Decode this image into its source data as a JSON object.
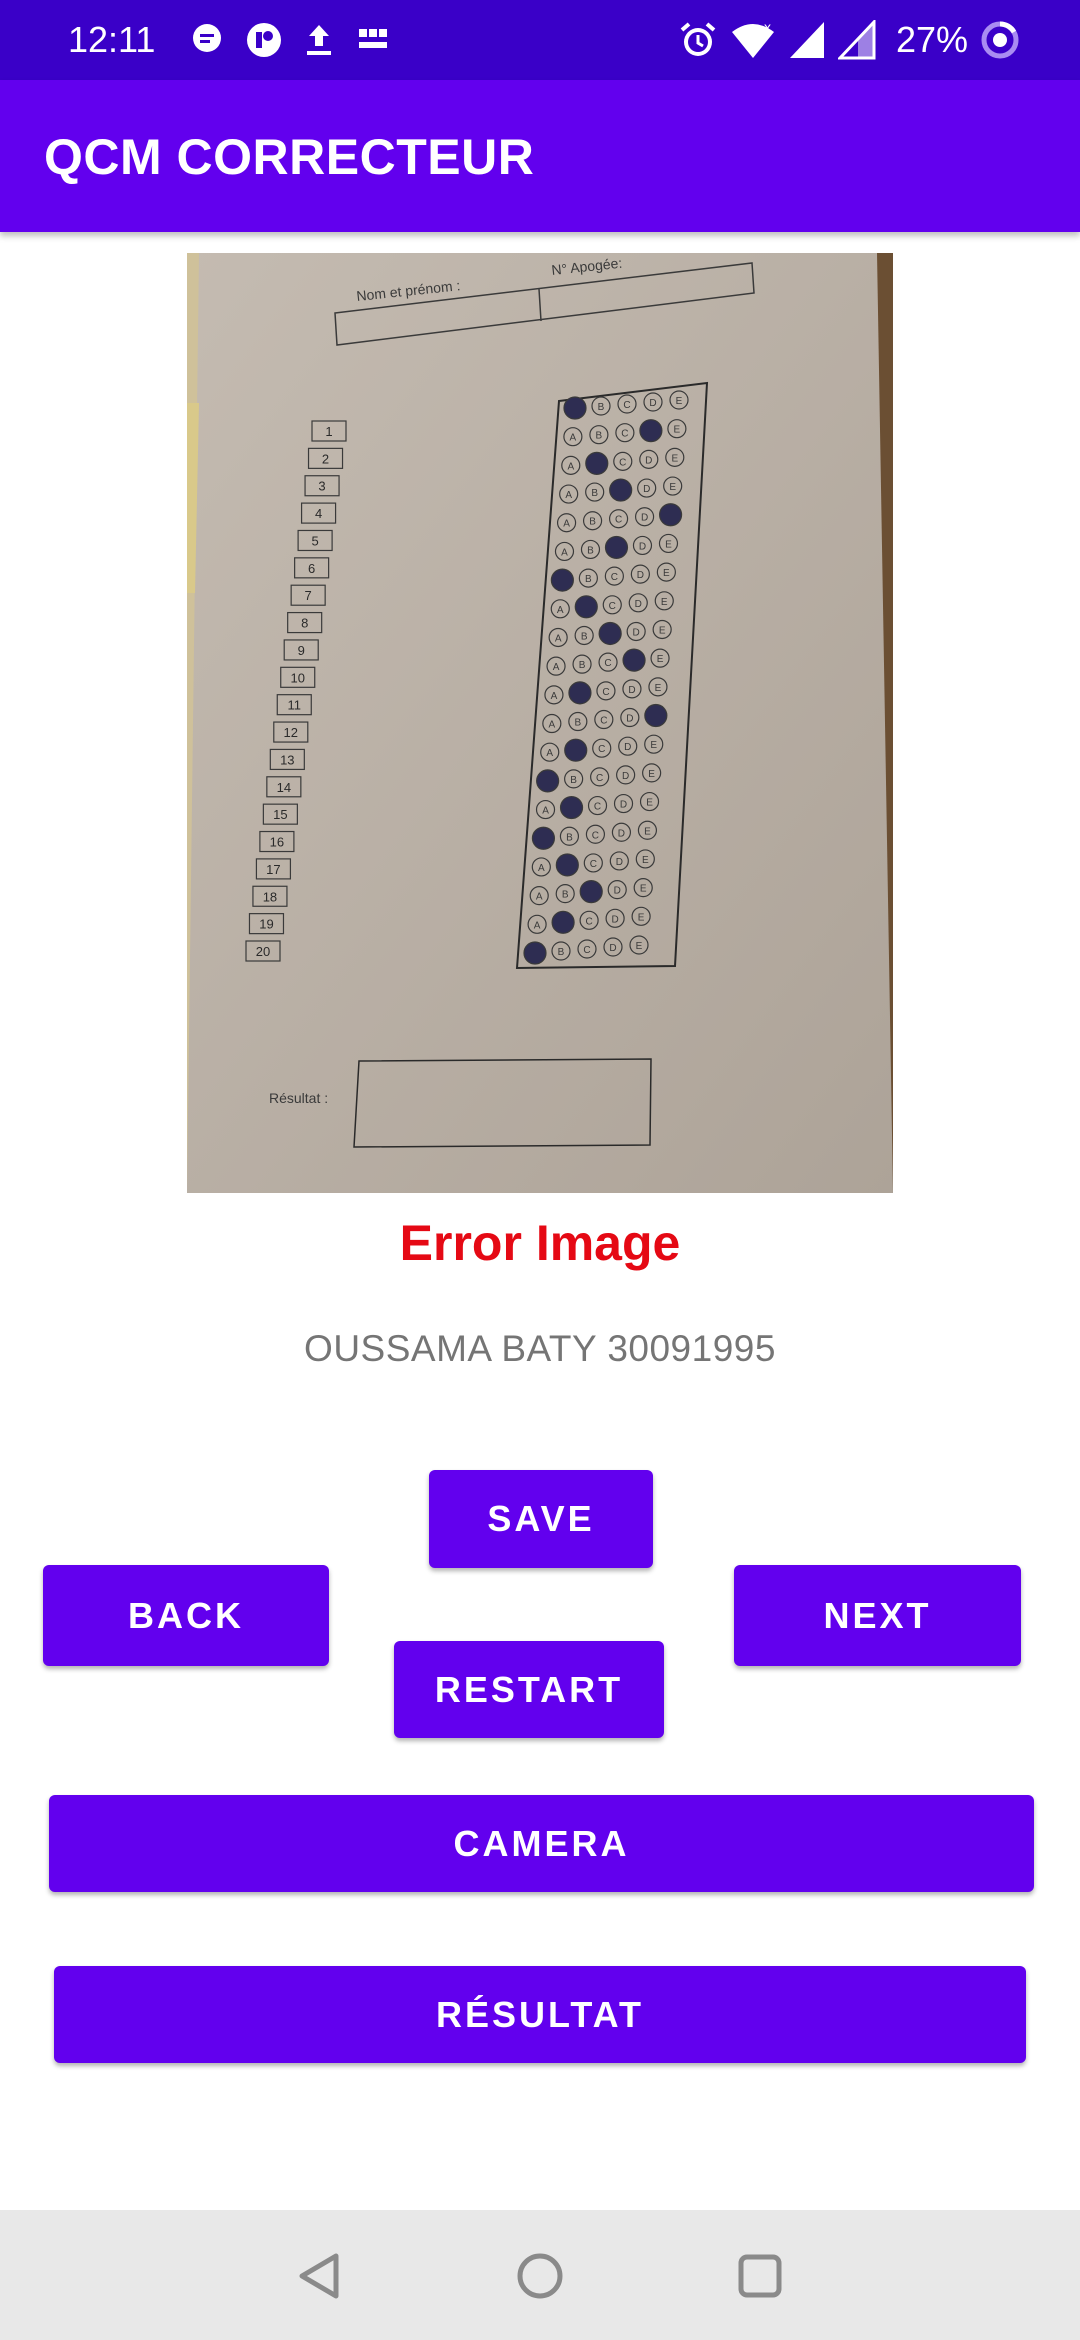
{
  "status_bar": {
    "time": "12:11",
    "battery_percent": "27%",
    "left_icons": [
      "message-icon",
      "app-icon",
      "upload-icon",
      "bbc-news-icon"
    ],
    "right_icons": [
      "alarm-icon",
      "wifi-icon",
      "signal-icon",
      "signal-icon",
      "battery-saver-icon"
    ]
  },
  "app_bar": {
    "title": "QCM CORRECTEUR"
  },
  "sheet_image": {
    "name_label": "Nom et prénom :",
    "apogee_label": "N° Apogée:",
    "result_label": "Résultat :",
    "question_numbers": [
      "1",
      "2",
      "3",
      "4",
      "5",
      "6",
      "7",
      "8",
      "9",
      "10",
      "11",
      "12",
      "13",
      "14",
      "15",
      "16",
      "17",
      "18",
      "19",
      "20"
    ],
    "choices": [
      "A",
      "B",
      "C",
      "D",
      "E"
    ],
    "marked_answers": [
      "A",
      "D",
      "B",
      "C",
      "E",
      "C",
      "A",
      "B",
      "C",
      "D",
      "B",
      "E",
      "B",
      "A",
      "B",
      "A",
      "B",
      "C",
      "B",
      "A"
    ]
  },
  "error_message": "Error Image",
  "student_info": "OUSSAMA BATY 30091995",
  "buttons": {
    "save": "SAVE",
    "back": "BACK",
    "next": "NEXT",
    "restart": "RESTART",
    "camera": "CAMERA",
    "result": "RÉSULTAT"
  },
  "colors": {
    "primary": "#6200ee",
    "primary_dark": "#3a00c8",
    "error": "#e50914",
    "secondary_text": "#757575"
  },
  "nav_bar": {
    "icons": [
      "back-triangle-icon",
      "home-circle-icon",
      "recents-square-icon"
    ]
  }
}
